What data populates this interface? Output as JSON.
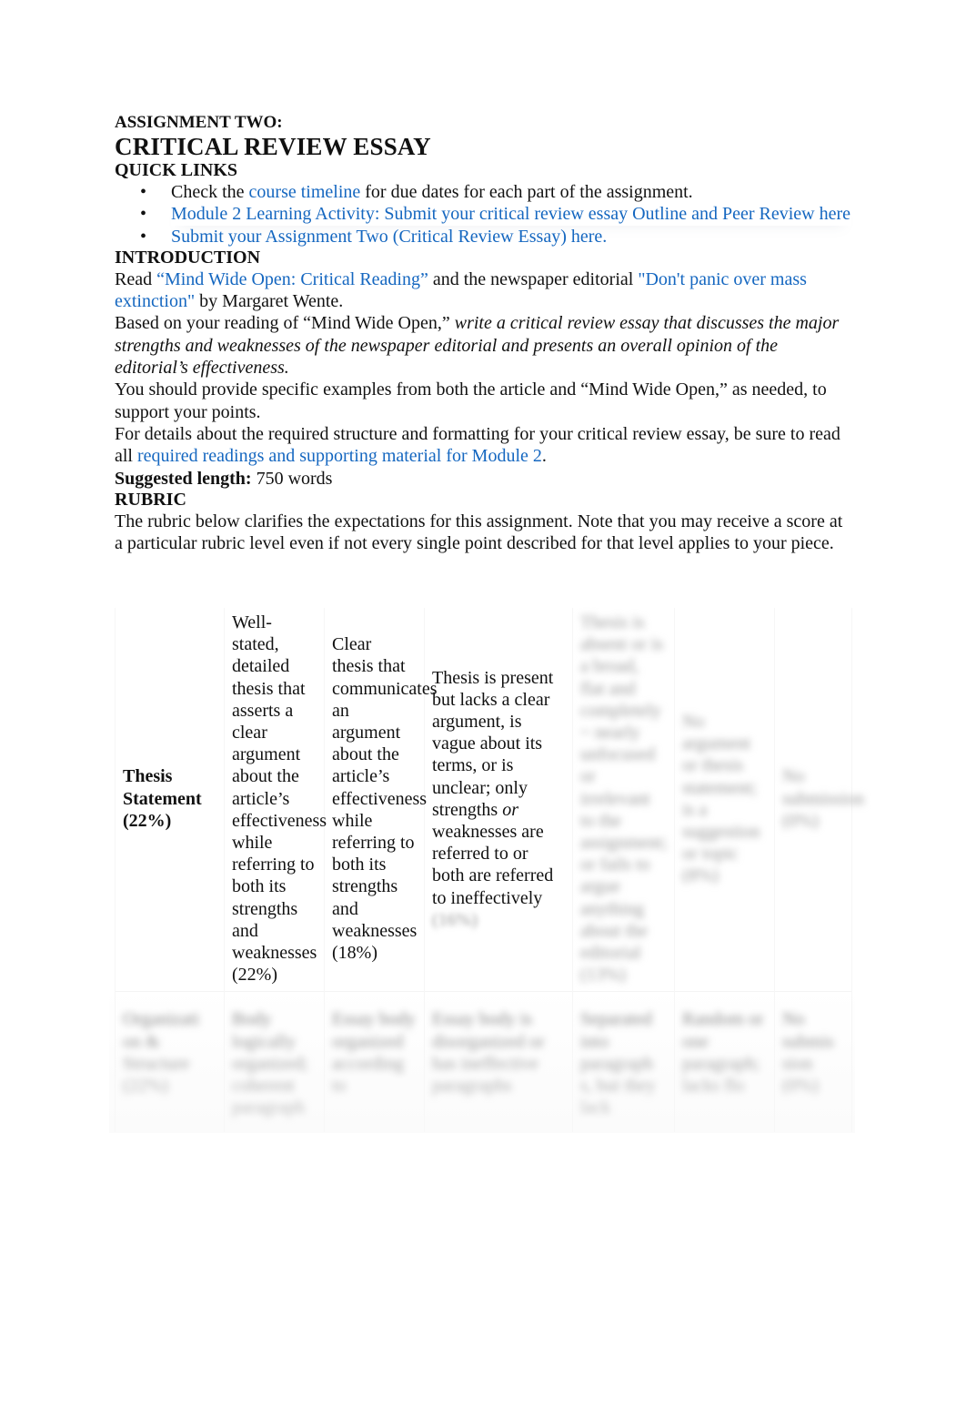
{
  "header": {
    "kicker": "ASSIGNMENT TWO:",
    "title": "CRITICAL REVIEW ESSAY"
  },
  "quick_links": {
    "heading": "QUICK LINKS",
    "items": [
      {
        "prefix": "Check the ",
        "link": "course timeline",
        "suffix": " for due dates for each part of the assignment."
      },
      {
        "link": "Module 2 Learning Activity: Submit your critical review essay Outline and Peer Review here"
      },
      {
        "link": "Submit your Assignment Two (Critical Review Essay) here."
      }
    ]
  },
  "introduction": {
    "heading": "INTRODUCTION",
    "p1": {
      "prefix": "Read ",
      "link1": "“Mind Wide Open: Critical Reading”",
      "middle": " and the newspaper editorial ",
      "link2": "\"Don't panic over mass extinction\"",
      "suffix": " by Margaret Wente."
    },
    "p2": {
      "prefix": "Based on your reading of “Mind Wide Open,” ",
      "emphasis": "write a critical review essay that discusses the major strengths and weaknesses of the newspaper editorial and presents an overall opinion of the editorial’s effectiveness."
    },
    "p3": "You should provide specific examples from both the article and “Mind Wide Open,” as needed, to support your points.",
    "p4": {
      "prefix": "For details about the required structure and formatting for your critical review essay, be sure to read all ",
      "link": "required readings and supporting material for Module 2",
      "suffix": "."
    },
    "length_label": "Suggested length:",
    "length_value": " 750 words"
  },
  "rubric": {
    "heading": "RUBRIC",
    "intro": "The rubric below clarifies the expectations for this assignment. Note that you may receive a score at a particular rubric level even if not every single point described for that level applies to your piece.",
    "rows": [
      {
        "criterion": "Thesis Statement (22%)",
        "levels": [
          "Well-stated, detailed thesis that asserts a clear argument about the article’s effectiveness while referring to both its strengths and weaknesses (22%)",
          "Clear thesis that communicates an argument about the article’s effectiveness while referring to both its strengths and weaknesses (18%)",
          {
            "part1": "Thesis is present but lacks a clear argument, is vague about its terms, or is unclear; only strengths ",
            "emphasis": "or",
            "part2": " weaknesses are referred to or both are referred to ineffectively",
            "blurred_tail": "(16%)"
          },
          "[blurred]",
          "[blurred]",
          "[blurred]"
        ]
      },
      {
        "criterion": "[blurred]",
        "levels": [
          "[blurred]",
          "[blurred]",
          "[blurred]",
          "[blurred]",
          "[blurred]",
          "[blurred]"
        ]
      }
    ]
  }
}
